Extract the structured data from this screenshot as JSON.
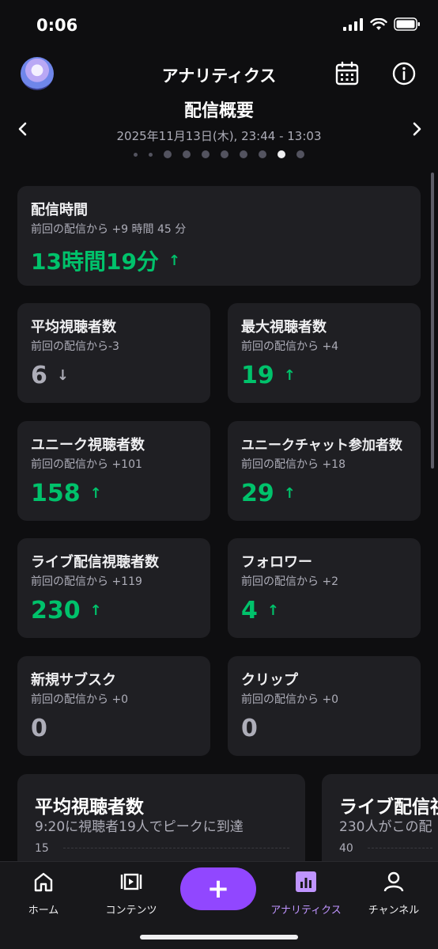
{
  "status_bar": {
    "time": "0:06"
  },
  "header": {
    "title": "アナリティクス"
  },
  "summary": {
    "title": "配信概要",
    "date": "2025年11月13日(木), 23:44 - 13:03",
    "active_dot": 8
  },
  "stats": {
    "stream_time": {
      "title": "配信時間",
      "sub": "前回の配信から +9 時間 45 分",
      "value": "13時間19分",
      "trend": "up"
    },
    "avg_viewers": {
      "title": "平均視聴者数",
      "sub": "前回の配信から-3",
      "value": "6",
      "trend": "down"
    },
    "max_viewers": {
      "title": "最大視聴者数",
      "sub": "前回の配信から +4",
      "value": "19",
      "trend": "up"
    },
    "unique_viewers": {
      "title": "ユニーク視聴者数",
      "sub": "前回の配信から +101",
      "value": "158",
      "trend": "up"
    },
    "unique_chatters": {
      "title": "ユニークチャット参加者数",
      "sub": "前回の配信から +18",
      "value": "29",
      "trend": "up"
    },
    "live_viewers": {
      "title": "ライブ配信視聴者数",
      "sub": "前回の配信から +119",
      "value": "230",
      "trend": "up"
    },
    "followers": {
      "title": "フォロワー",
      "sub": "前回の配信から +2",
      "value": "4",
      "trend": "up"
    },
    "new_subs": {
      "title": "新規サブスク",
      "sub": "前回の配信から +0",
      "value": "0",
      "trend": "flat"
    },
    "clips": {
      "title": "クリップ",
      "sub": "前回の配信から +0",
      "value": "0",
      "trend": "flat"
    }
  },
  "charts": [
    {
      "title": "平均視聴者数",
      "sub": "9:20に視聴者19人でピークに到達",
      "tick": "15"
    },
    {
      "title": "ライブ配信視",
      "sub": "230人がこの配",
      "tick": "40"
    }
  ],
  "tabbar": {
    "home": "ホーム",
    "content": "コンテンツ",
    "create": "+",
    "analytics": "アナリティクス",
    "channel": "チャンネル"
  },
  "colors": {
    "accent": "#9147ff",
    "positive": "#00c26b",
    "card": "#1f1f23",
    "background": "#0e0e10"
  }
}
